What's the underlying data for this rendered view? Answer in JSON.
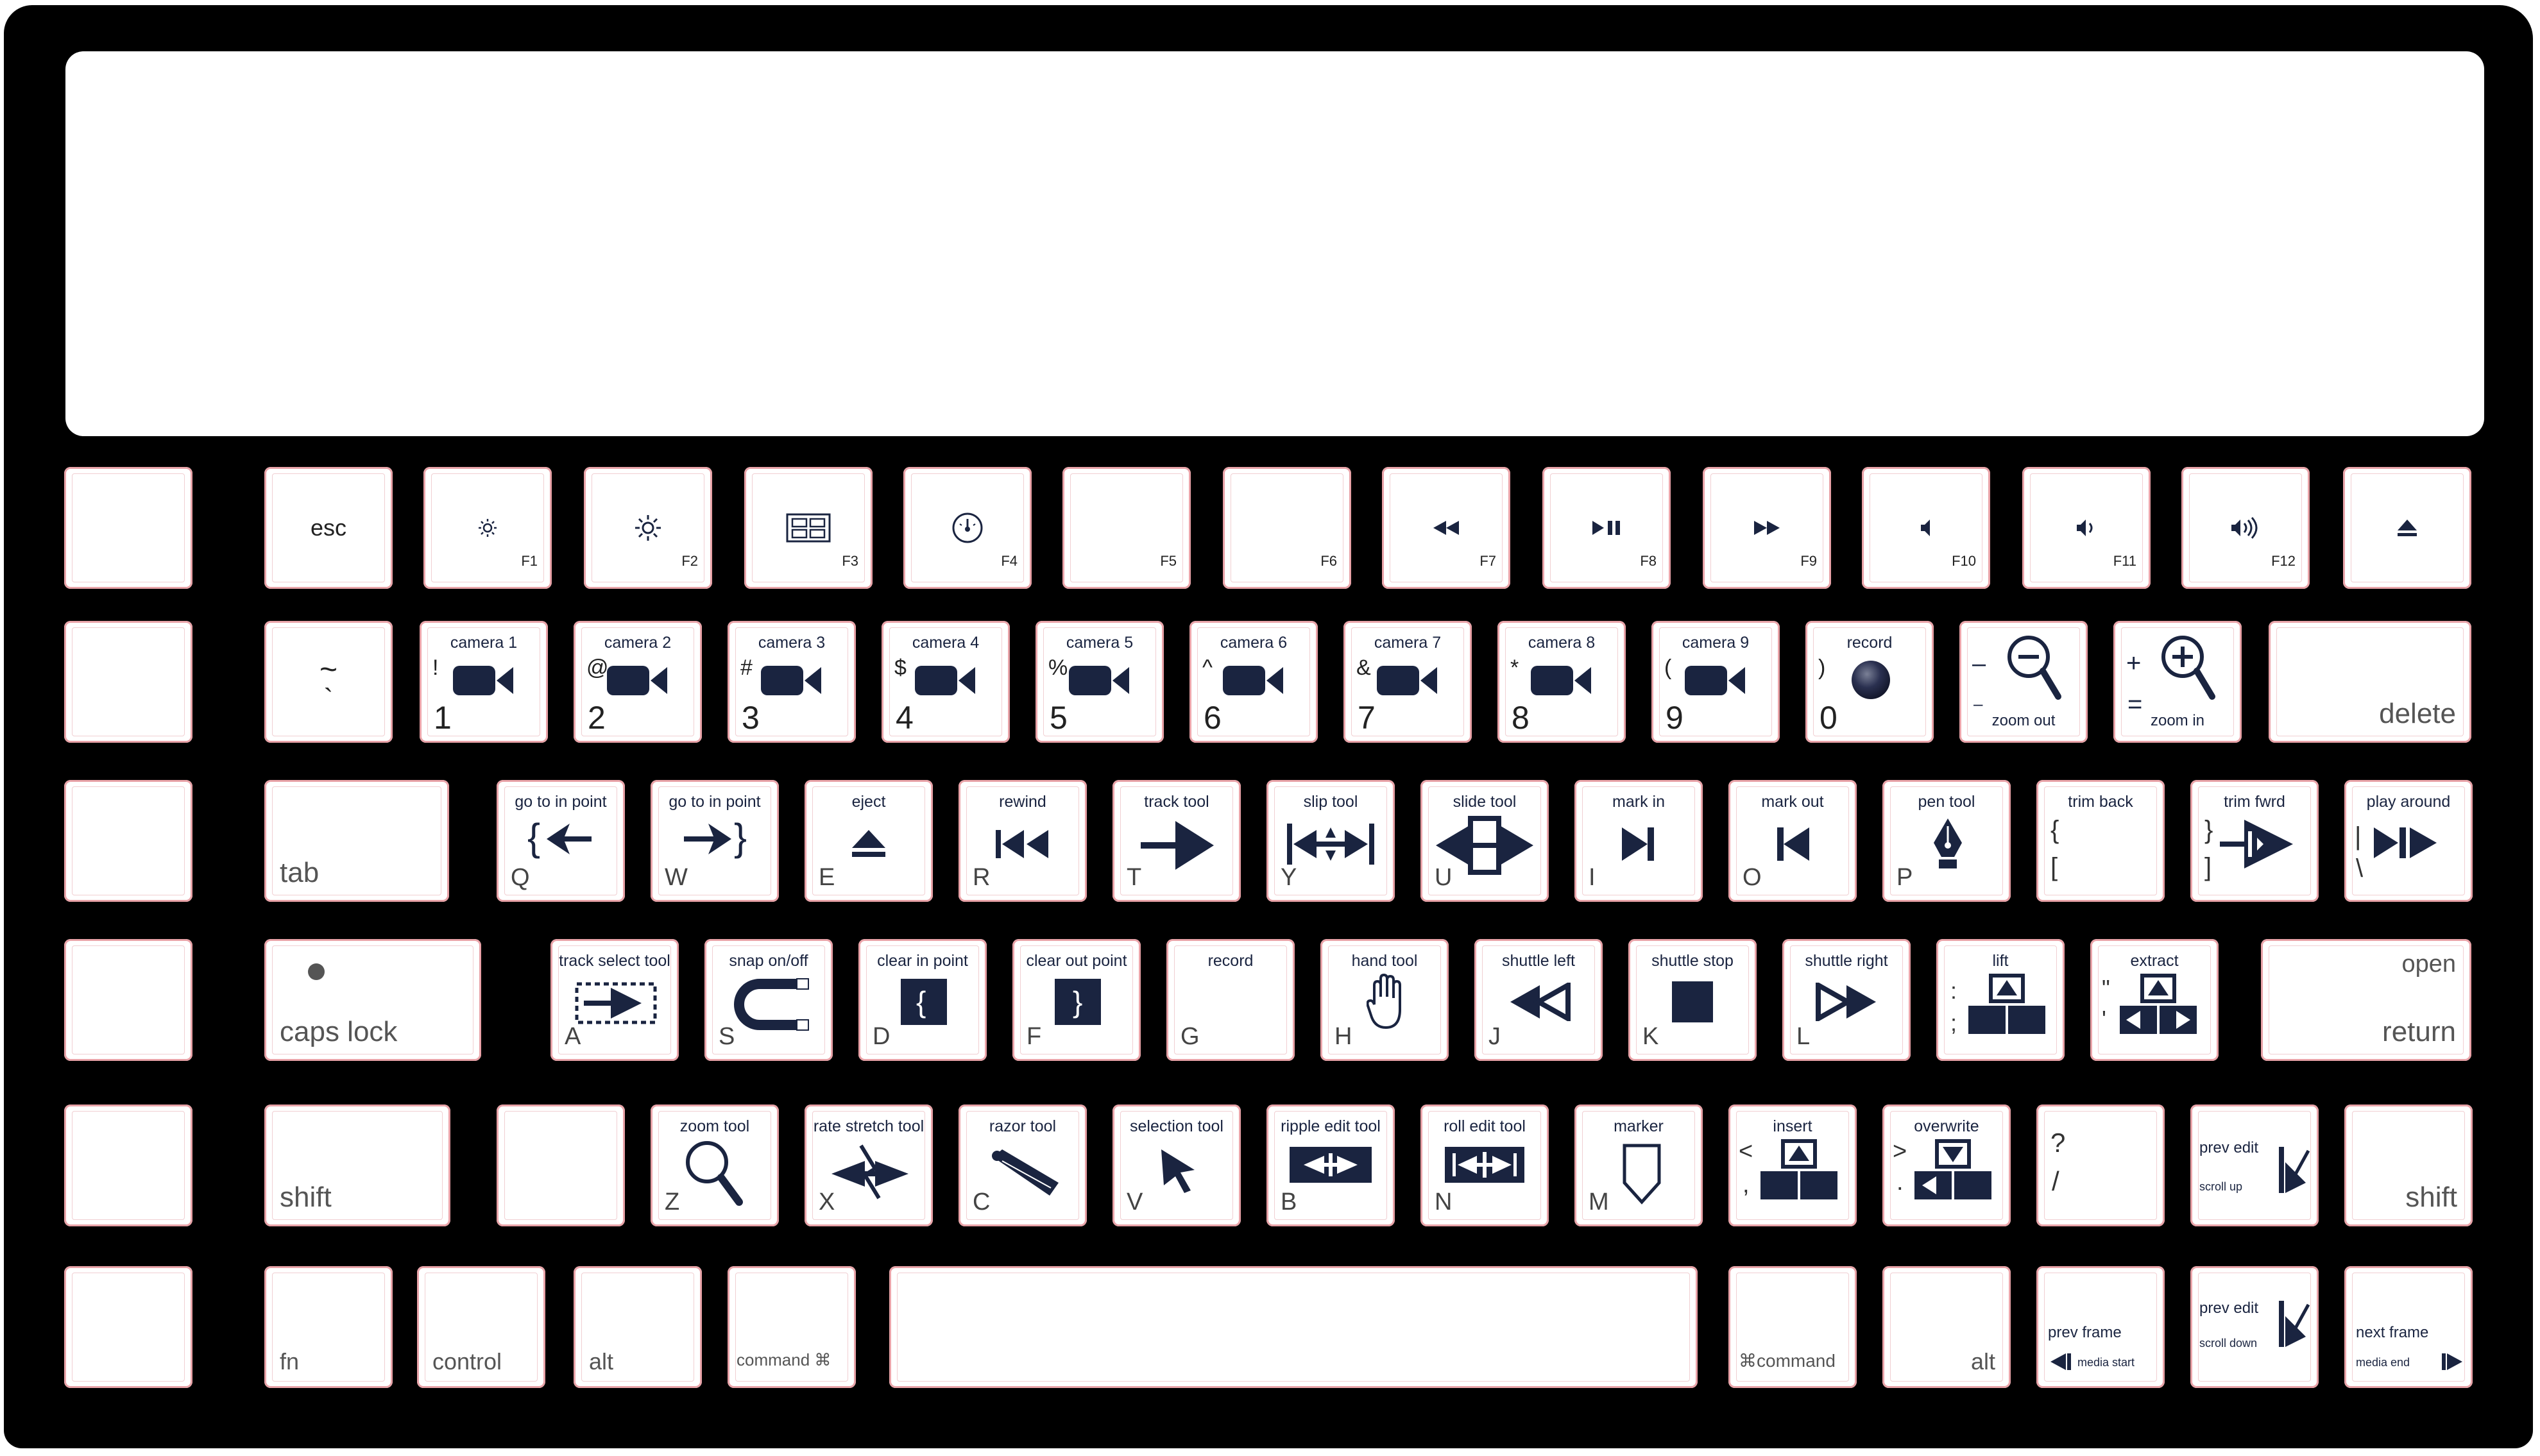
{
  "colors": {
    "board": "#000000",
    "key_face": "#ffffff",
    "key_outline": "#e9a3a8",
    "icon": "#1a2440"
  },
  "function_row": {
    "esc": "esc",
    "f1": "F1",
    "f2": "F2",
    "f3": "F3",
    "f4": "F4",
    "f5": "F5",
    "f6": "F6",
    "f7": "F7",
    "f8": "F8",
    "f9": "F9",
    "f10": "F10",
    "f11": "F11",
    "f12": "F12",
    "icons": [
      "brightness-down-icon",
      "brightness-up-icon",
      "mission-control-icon",
      "dashboard-icon",
      "rewind-icon",
      "play-pause-icon",
      "fast-forward-icon",
      "mute-icon",
      "volume-down-icon",
      "volume-up-icon",
      "eject-icon"
    ]
  },
  "number_row": {
    "tilde": "~",
    "backtick": "`",
    "keys": [
      {
        "top": "camera 1",
        "shift": "!",
        "num": "1"
      },
      {
        "top": "camera 2",
        "shift": "@",
        "num": "2"
      },
      {
        "top": "camera 3",
        "shift": "#",
        "num": "3"
      },
      {
        "top": "camera 4",
        "shift": "$",
        "num": "4"
      },
      {
        "top": "camera 5",
        "shift": "%",
        "num": "5"
      },
      {
        "top": "camera 6",
        "shift": "^",
        "num": "6"
      },
      {
        "top": "camera 7",
        "shift": "&",
        "num": "7"
      },
      {
        "top": "camera 8",
        "shift": "*",
        "num": "8"
      },
      {
        "top": "camera 9",
        "shift": "(",
        "num": "9"
      },
      {
        "top": "record",
        "shift": ")",
        "num": "0"
      }
    ],
    "minus": {
      "top": "–",
      "bottom": "–",
      "label": "zoom out"
    },
    "plus": {
      "top": "+",
      "bottom": "=",
      "label": "zoom in"
    },
    "delete": "delete"
  },
  "qwerty_row": {
    "tab": "tab",
    "keys": [
      {
        "top": "go to in point",
        "letter": "Q"
      },
      {
        "top": "go to in point",
        "letter": "W"
      },
      {
        "top": "eject",
        "letter": "E"
      },
      {
        "top": "rewind",
        "letter": "R"
      },
      {
        "top": "track tool",
        "letter": "T"
      },
      {
        "top": "slip tool",
        "letter": "Y"
      },
      {
        "top": "slide tool",
        "letter": "U"
      },
      {
        "top": "mark in",
        "letter": "I"
      },
      {
        "top": "mark out",
        "letter": "O"
      },
      {
        "top": "pen tool",
        "letter": "P"
      }
    ],
    "bracket_left": {
      "top": "trim back",
      "a": "{",
      "b": "["
    },
    "bracket_right": {
      "top": "trim fwrd",
      "a": "}",
      "b": "]"
    },
    "backslash": {
      "top": "play around",
      "a": "|",
      "b": "\\"
    }
  },
  "home_row": {
    "caps": "caps lock",
    "keys": [
      {
        "top": "track select tool",
        "letter": "A"
      },
      {
        "top": "snap on/off",
        "letter": "S"
      },
      {
        "top": "clear in point",
        "letter": "D"
      },
      {
        "top": "clear out point",
        "letter": "F"
      },
      {
        "top": "record",
        "letter": "G"
      },
      {
        "top": "hand tool",
        "letter": "H"
      },
      {
        "top": "shuttle left",
        "letter": "J"
      },
      {
        "top": "shuttle stop",
        "letter": "K"
      },
      {
        "top": "shuttle right",
        "letter": "L"
      }
    ],
    "semicolon": {
      "top": "lift",
      "a": ":",
      "b": ";"
    },
    "quote": {
      "top": "extract",
      "a": "\"",
      "b": "'"
    },
    "return": {
      "top": "open",
      "bottom": "return"
    }
  },
  "bottom_row": {
    "shift": "shift",
    "keys": [
      {
        "top": "zoom tool",
        "letter": "Z"
      },
      {
        "top": "rate stretch tool",
        "letter": "X"
      },
      {
        "top": "razor tool",
        "letter": "C"
      },
      {
        "top": "selection tool",
        "letter": "V"
      },
      {
        "top": "ripple edit tool",
        "letter": "B"
      },
      {
        "top": "roll edit tool",
        "letter": "N"
      },
      {
        "top": "marker",
        "letter": "M"
      }
    ],
    "comma": {
      "top": "insert",
      "a": "<",
      "b": ","
    },
    "period": {
      "top": "overwrite",
      "a": ">",
      "b": "."
    },
    "slash": {
      "a": "?",
      "b": "/"
    },
    "prev_edit": {
      "label": "prev edit",
      "sub": "scroll up"
    },
    "shift_right": "shift"
  },
  "modifier_row": {
    "fn": "fn",
    "control": "control",
    "alt": "alt",
    "command_left": "command ⌘",
    "command_right": "⌘command",
    "alt_right": "alt",
    "prev_frame": {
      "label": "prev frame",
      "sub": "media start"
    },
    "prev_edit": {
      "label": "prev edit",
      "sub": "scroll down"
    },
    "next_frame": {
      "label": "next frame",
      "sub": "media end"
    }
  }
}
